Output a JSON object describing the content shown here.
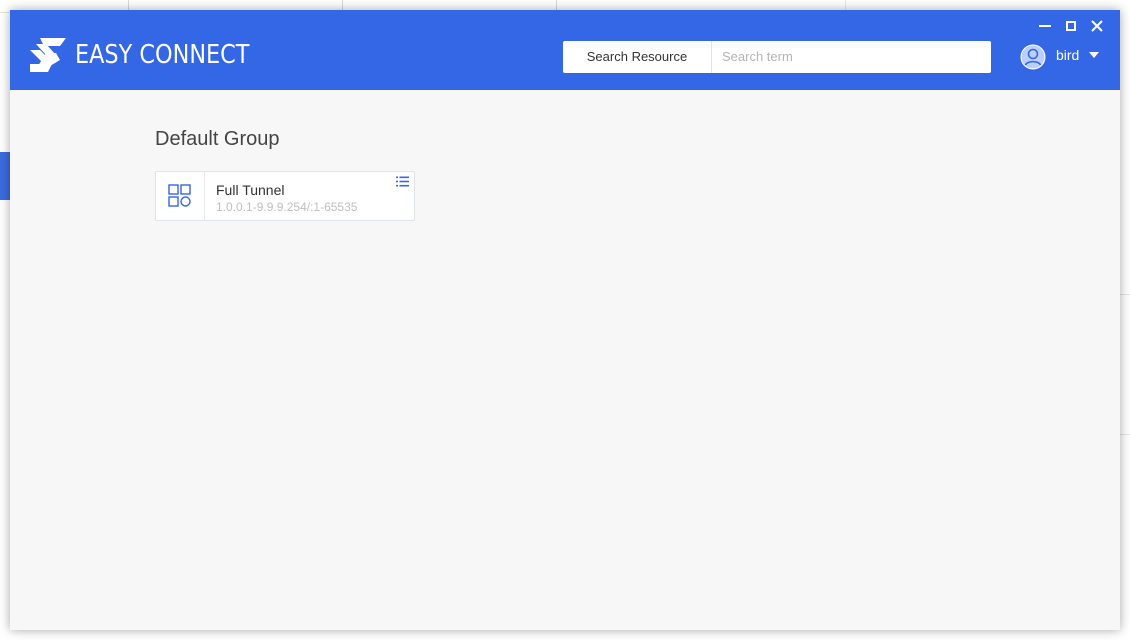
{
  "app": {
    "brand": "EASY CONNECT"
  },
  "search": {
    "category_label": "Search Resource",
    "placeholder": "Search term",
    "value": ""
  },
  "user": {
    "name": "bird"
  },
  "group": {
    "title": "Default Group",
    "resources": [
      {
        "name": "Full Tunnel",
        "address": "1.0.0.1-9.9.9.254/:1-65535"
      }
    ]
  },
  "colors": {
    "header_bg": "#3467e6",
    "content_bg": "#f7f7f7",
    "icon_accent": "#3467e6"
  },
  "icons": {
    "logo": "easyconnect-s-logo",
    "minimize": "minimize-icon",
    "maximize": "maximize-icon",
    "close": "close-icon",
    "avatar": "user-avatar-icon",
    "dropdown": "caret-down-icon",
    "resource": "app-grid-icon",
    "menu": "list-menu-icon"
  }
}
